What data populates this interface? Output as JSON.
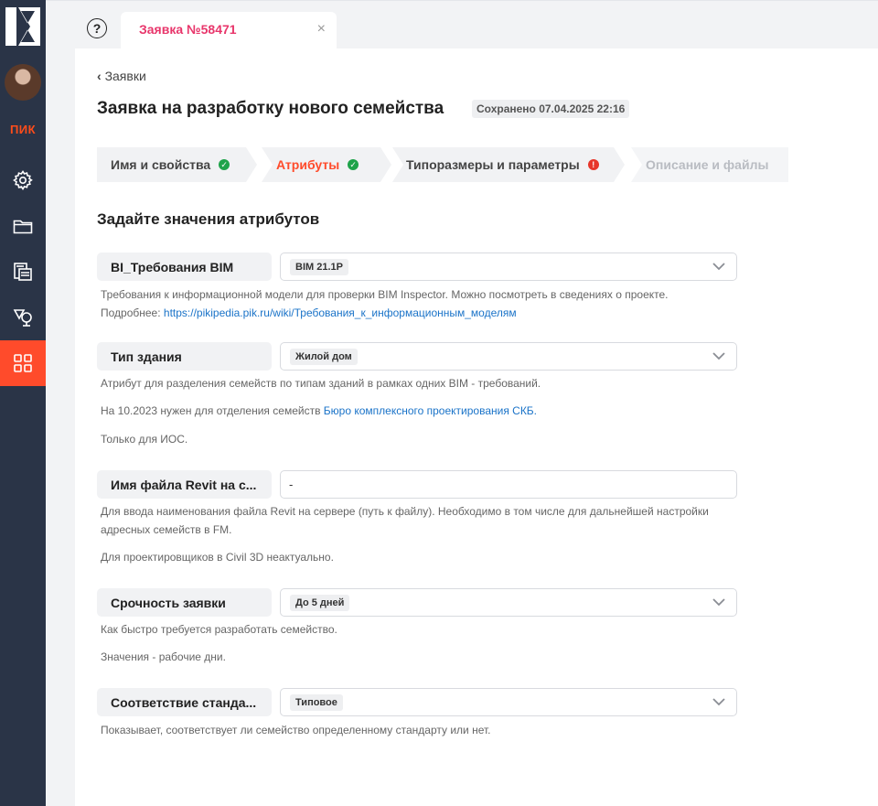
{
  "header": {
    "tab_label": "Заявка №58471",
    "close_glyph": "×",
    "help_glyph": "?"
  },
  "sidebar": {
    "brand": "ПИК",
    "items": [
      {
        "icon": "gear-icon"
      },
      {
        "icon": "folder-icon"
      },
      {
        "icon": "catalog-icon"
      },
      {
        "icon": "shapes-icon"
      },
      {
        "icon": "grid-icon",
        "active": true
      }
    ]
  },
  "breadcrumb": {
    "back_label": "Заявки"
  },
  "page": {
    "title": "Заявка на разработку нового семейства",
    "saved": "Сохранено 07.04.2025 22:16",
    "section_title": "Задайте значения атрибутов"
  },
  "steps": [
    {
      "label": "Имя и свойства",
      "status": "done"
    },
    {
      "label": "Атрибуты",
      "status": "done",
      "current": true
    },
    {
      "label": "Типоразмеры и параметры",
      "status": "error"
    },
    {
      "label": "Описание и файлы",
      "status": "disabled"
    }
  ],
  "fields": [
    {
      "label": "BI_Требования BIM",
      "value": "BIM 21.1P",
      "help1": "Требования к информационной модели для проверки BIM Inspector. Можно посмотреть в сведениях о проекте.",
      "help2_prefix": "Подробнее: ",
      "help2_link": "https://pikipedia.pik.ru/wiki/Требования_к_информационным_моделям"
    },
    {
      "label": "Тип здания",
      "value": "Жилой дом",
      "help1": "Атрибут для разделения семейств по типам зданий в рамках одних BIM - требований.",
      "help2_prefix": "На 10.2023 нужен для отделения семейств ",
      "help2_link": "Бюро комплексного проектирования СКБ.",
      "help3": "Только для ИОС."
    },
    {
      "label": "Имя файла Revit на с...",
      "value": "-",
      "help1": "Для ввода наименования файла Revit на сервере (путь к файлу). Необходимо в том числе для дальнейшей настройки",
      "help1b": "адресных семейств в FM.",
      "help2": "Для проектировщиков в Civil 3D неактуально."
    },
    {
      "label": "Срочность заявки",
      "value": "До 5 дней",
      "help1": "Как быстро требуется разработать семейство.",
      "help2": "Значения - рабочие дни."
    },
    {
      "label": "Соответствие станда...",
      "value": "Типовое",
      "help1": "Показывает, соответствует ли семейство определенному стандарту или нет."
    }
  ],
  "colors": {
    "accent": "#ff4b2b",
    "tab_title": "#e8366b",
    "sidebar_bg": "#2a3447",
    "success": "#1fa34a",
    "error": "#e7362a",
    "link": "#1a73c8"
  }
}
